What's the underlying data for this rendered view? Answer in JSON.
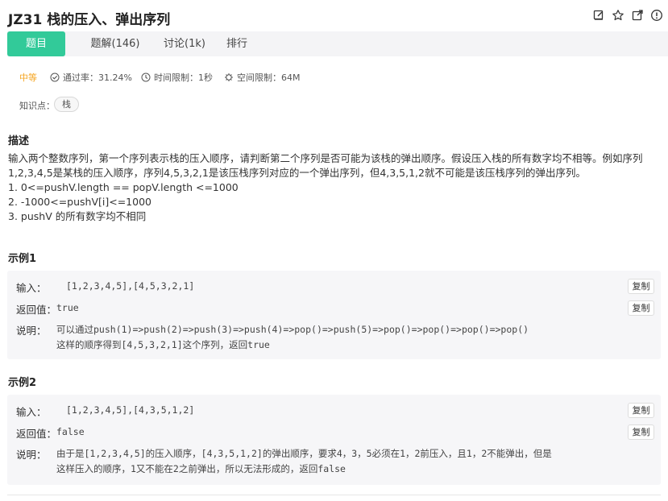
{
  "header": {
    "title": "JZ31  栈的压入、弹出序列",
    "icons": [
      "edit-icon",
      "star-icon",
      "share-icon",
      "info-icon"
    ]
  },
  "tabs": [
    {
      "label": "题目",
      "active": true
    },
    {
      "label": "题解(146)",
      "active": false
    },
    {
      "label": "讨论(1k)",
      "active": false
    },
    {
      "label": "排行",
      "active": false
    }
  ],
  "meta": {
    "difficulty": "中等",
    "pass_rate": "通过率：31.24%",
    "time_limit": "时间限制：1秒",
    "space_limit": "空间限制：64M",
    "difficulty_color": "#f5a623"
  },
  "knowledge": {
    "label": "知识点：",
    "tags": [
      "栈"
    ]
  },
  "description": {
    "heading": "描述",
    "paragraph": "输入两个整数序列，第一个序列表示栈的压入顺序，请判断第二个序列是否可能为该栈的弹出顺序。假设压入栈的所有数字均不相等。例如序列1,2,3,4,5是某栈的压入顺序，序列4,5,3,2,1是该压栈序列对应的一个弹出序列，但4,3,5,1,2就不可能是该压栈序列的弹出序列。",
    "constraints": [
      "1. 0<=pushV.length == popV.length <=1000",
      "2. -1000<=pushV[i]<=1000",
      "3. pushV 的所有数字均不相同"
    ]
  },
  "examples": [
    {
      "heading": "示例1",
      "input_label": "输入：",
      "input": "[1,2,3,4,5],[4,5,3,2,1]",
      "output_label": "返回值：",
      "output": "true",
      "explain_label": "说明：",
      "explain_lines": [
        "可以通过push(1)=>push(2)=>push(3)=>push(4)=>pop()=>push(5)=>pop()=>pop()=>pop()=>pop()",
        "这样的顺序得到[4,5,3,2,1]这个序列，返回true"
      ],
      "copy_label": "复制"
    },
    {
      "heading": "示例2",
      "input_label": "输入：",
      "input": "[1,2,3,4,5],[4,3,5,1,2]",
      "output_label": "返回值：",
      "output": "false",
      "explain_label": "说明：",
      "explain_lines": [
        "由于是[1,2,3,4,5]的压入顺序，[4,3,5,1,2]的弹出顺序，要求4，3，5必须在1，2前压入，且1，2不能弹出，但是",
        "这样压入的顺序，1又不能在2之前弹出，所以无法形成的，返回false"
      ],
      "copy_label": "复制"
    }
  ],
  "colors": {
    "accent": "#32ca99",
    "tab_bar_bg": "#f4f4f6",
    "example_bg": "#f6f6f8"
  }
}
